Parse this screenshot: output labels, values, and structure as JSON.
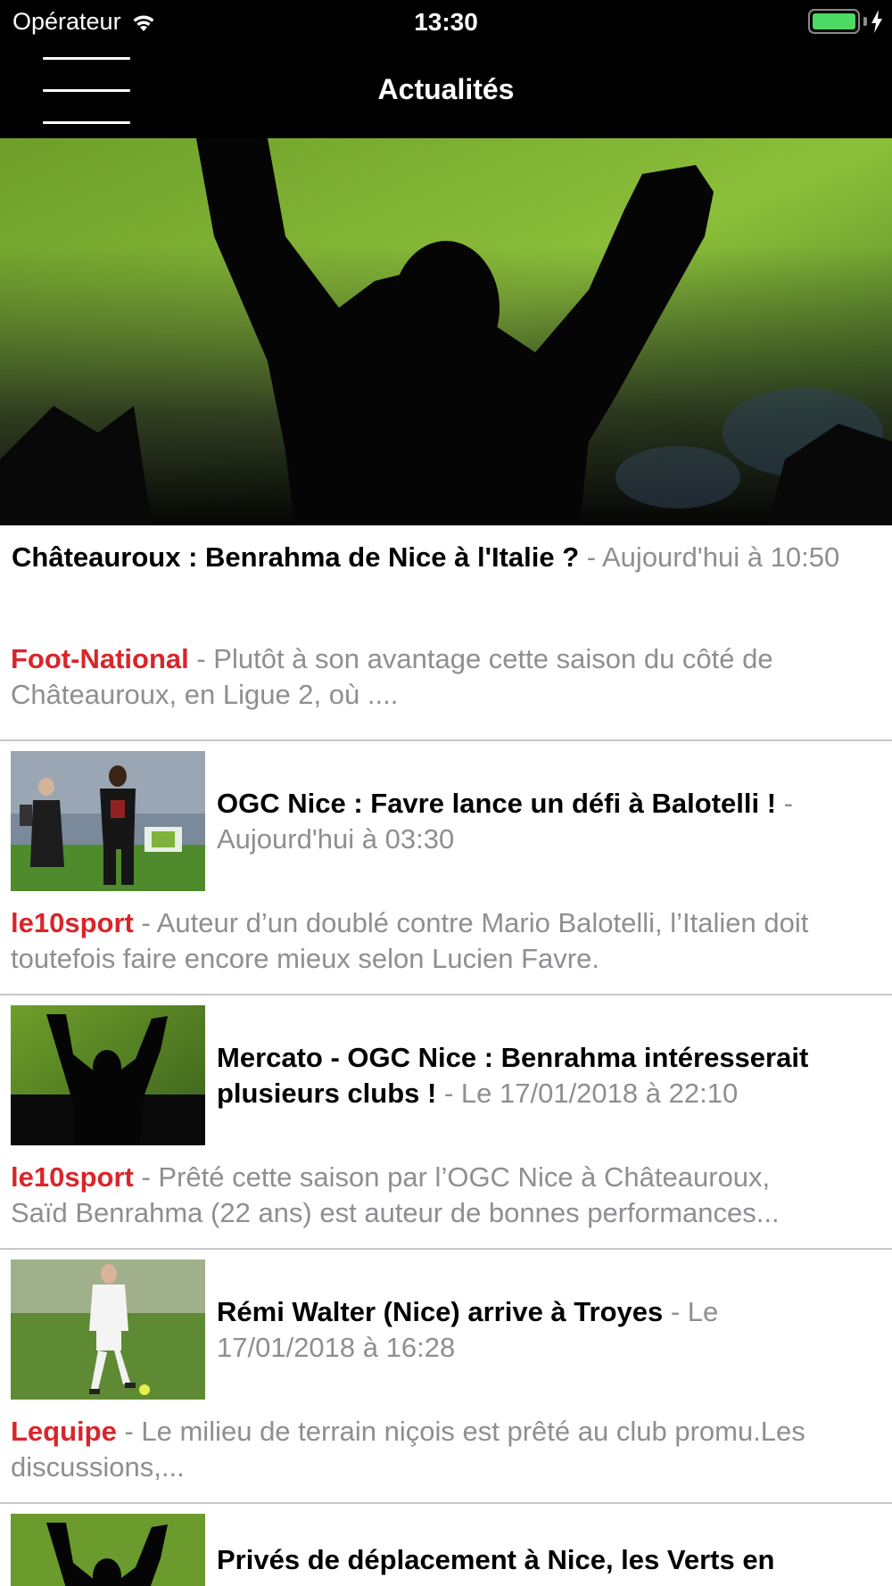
{
  "status_bar": {
    "carrier": "Opérateur",
    "time": "13:30",
    "wifi_icon": "wifi-icon",
    "battery_icon": "battery-icon",
    "battery_level": 1.0,
    "charging_icon": "bolt-icon"
  },
  "nav": {
    "title": "Actualités",
    "menu_icon": "hamburger-menu-icon"
  },
  "hero": {
    "image": "stadium-fan-silhouette-photo"
  },
  "articles": [
    {
      "title": "Châteauroux : Benrahma de Nice à l'Italie ?",
      "date": " - Aujourd'hui à 10:50",
      "source": "Foot-National",
      "summary": " - Plutôt à son avantage cette saison du côté de Châteauroux, en Ligue 2, où ....",
      "image": null
    },
    {
      "title": "OGC Nice : Favre lance un défi à Balotelli !",
      "date": " - Aujourd'hui à 03:30",
      "source": "le10sport",
      "summary": " - Auteur d’un doublé contre Mario Balotelli, l’Italien doit toutefois faire encore mieux selon Lucien Favre.",
      "image": "coach-and-player-photo"
    },
    {
      "title": "Mercato - OGC Nice : Benrahma intéresserait plusieurs clubs !",
      "date": " - Le 17/01/2018 à 22:10",
      "source": "le10sport",
      "summary_line1": " - Prêté cette saison par l’OGC Nice à Châteauroux,",
      "summary_line2": "Saïd Benrahma (22 ans) est auteur de bonnes performances...",
      "image": "stadium-fan-silhouette-photo"
    },
    {
      "title": "Rémi Walter (Nice) arrive à Troyes",
      "date": " - Le 17/01/2018 à 16:28",
      "source": "Lequipe",
      "summary": " - Le milieu de terrain niçois est prêté au club promu.Les discussions,...",
      "image": "player-on-pitch-photo"
    },
    {
      "title": "Privés de déplacement à Nice, les Verts en",
      "image": "stadium-fan-silhouette-photo"
    }
  ],
  "colors": {
    "bar_background": "#000000",
    "source_red": "#d9252a",
    "secondary_gray": "#8e8e93",
    "separator": "#c8c8c8",
    "battery_green": "#4cd964"
  }
}
